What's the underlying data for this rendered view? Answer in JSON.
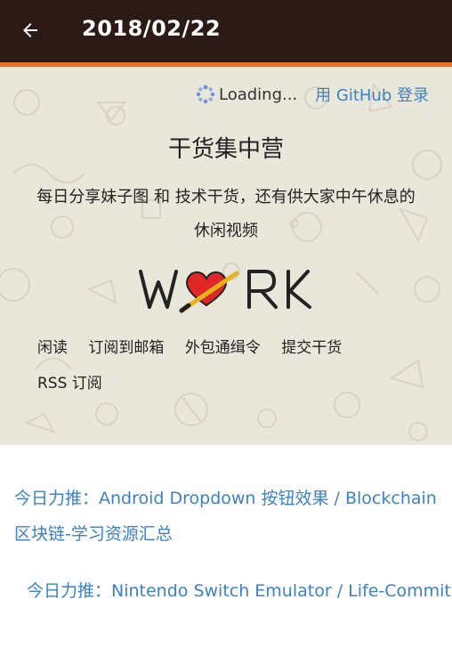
{
  "appbar": {
    "title": "2018/02/22",
    "back_icon": "arrow-left-icon"
  },
  "colors": {
    "appbar": "#2b1a16",
    "accent": "#e5732e",
    "link": "#3d82c4",
    "hero_bg": "#e9e6da"
  },
  "header": {
    "loading": "Loading...",
    "github_login": "用 GitHub 登录",
    "site_title": "干货集中营",
    "site_desc": "每日分享妹子图 和 技术干货，还有供大家中午休息的休闲视频",
    "logo_text": "WORK"
  },
  "nav": {
    "links": [
      "闲读",
      "订阅到邮箱",
      "外包通缉令",
      "提交干货",
      "RSS 订阅"
    ]
  },
  "articles": [
    "今日力推：Android Dropdown 按钮效果 / Blockchain 区块链-学习资源汇总",
    "今日力推：Nintendo Switch Emulator / Life-Commit"
  ]
}
